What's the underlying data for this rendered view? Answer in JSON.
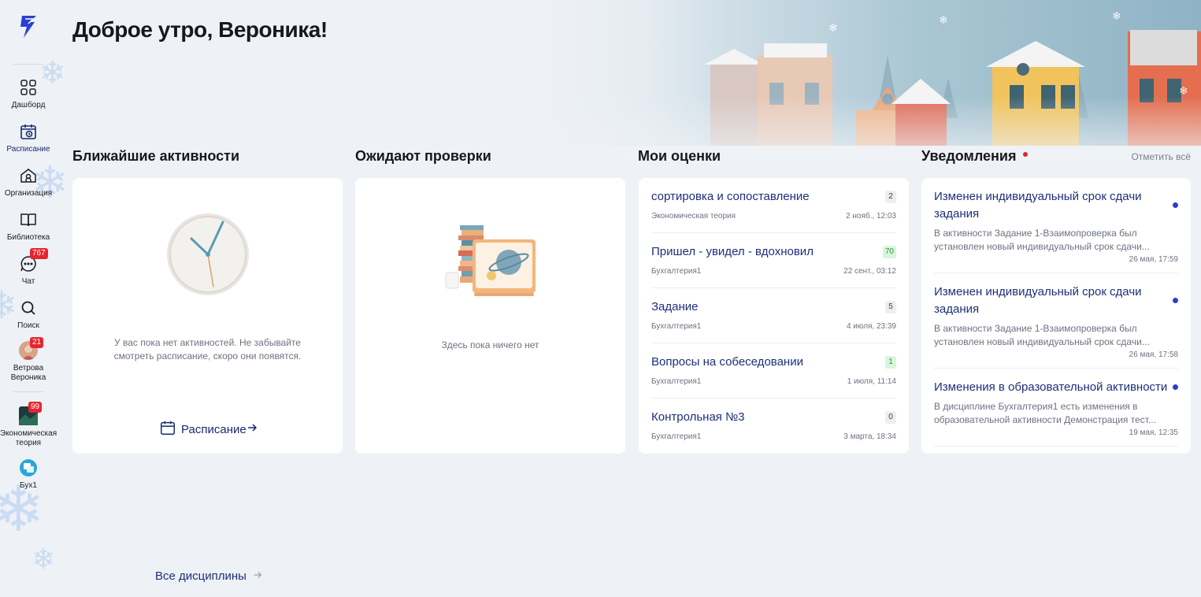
{
  "sidebar": {
    "items": [
      {
        "label": "Дашборд",
        "icon": "dashboard-grid-icon"
      },
      {
        "label": "Расписание",
        "icon": "calendar-clock-icon"
      },
      {
        "label": "Организация",
        "icon": "organization-home-icon"
      },
      {
        "label": "Библиотека",
        "icon": "book-icon"
      },
      {
        "label": "Чат",
        "icon": "chat-icon",
        "badge": "767"
      },
      {
        "label": "Поиск",
        "icon": "search-icon"
      },
      {
        "label": "Ветрова Вероника",
        "icon": "avatar",
        "badge": "21"
      },
      {
        "label": "Экономическая теория",
        "icon": "course-avatar",
        "badge": "99"
      },
      {
        "label": "Бух1",
        "icon": "course-avatar"
      }
    ]
  },
  "header": {
    "greeting": "Доброе утро, Вероника!"
  },
  "sections": {
    "activities": {
      "title": "Ближайшие активности",
      "empty_text": "У вас пока нет активностей. Не забывайте смотреть расписание, скоро они появятся.",
      "link_label": "Расписание"
    },
    "review": {
      "title": "Ожидают проверки",
      "empty_text": "Здесь пока ничего нет"
    },
    "grades": {
      "title": "Мои оценки",
      "items": [
        {
          "title": "сортировка и сопоставление",
          "course": "Экономическая теория",
          "date": "2 нояб., 12:03",
          "score": "2"
        },
        {
          "title": "Пришел - увидел - вдохновил",
          "course": "Бухгалтерия1",
          "date": "22 сент., 03:12",
          "score": "70"
        },
        {
          "title": "Задание",
          "course": "Бухгалтерия1",
          "date": "4 июля, 23:39",
          "score": "5"
        },
        {
          "title": "Вопросы на собеседовании",
          "course": "Бухгалтерия1",
          "date": "1 июля, 11:14",
          "score": "1"
        },
        {
          "title": "Контрольная №3",
          "course": "Бухгалтерия1",
          "date": "3 марта, 18:34",
          "score": "0"
        }
      ]
    },
    "notifications": {
      "title": "Уведомления",
      "mark_all": "Отметить всё",
      "items": [
        {
          "title": "Изменен индивидуальный срок сдачи задания",
          "desc": "В активности Задание 1-Взаимопроверка был установлен новый индивидуальный срок сдачи...",
          "time": "26 мая, 17:59"
        },
        {
          "title": "Изменен индивидуальный срок сдачи задания",
          "desc": "В активности Задание 1-Взаимопроверка был установлен новый индивидуальный срок сдачи...",
          "time": "26 мая, 17:58"
        },
        {
          "title": "Изменения в образовательной активности",
          "desc": "В дисциплине Бухгалтерия1 есть изменения в образовательной активности Демонстрация тест...",
          "time": "19 мая, 12:35"
        }
      ]
    }
  },
  "footer": {
    "all_disciplines": "Все дисциплины"
  },
  "colors": {
    "accent": "#1e2f7a",
    "badge": "#e5262f",
    "unread": "#2b3fd0",
    "good_score": "#2e9b3b"
  }
}
